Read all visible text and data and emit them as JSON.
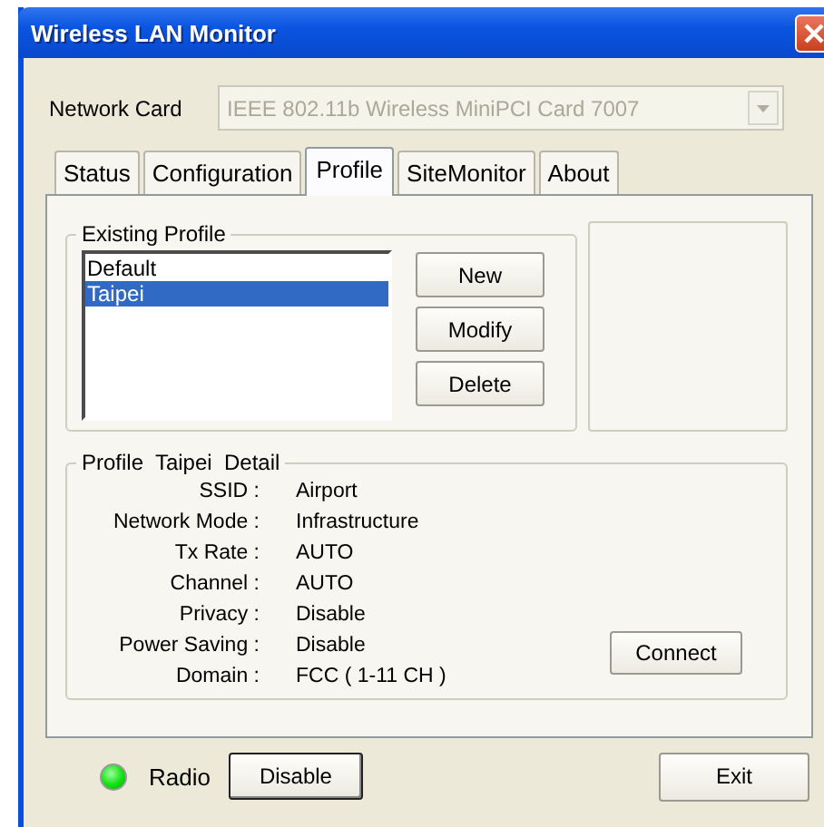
{
  "window": {
    "title": "Wireless LAN Monitor"
  },
  "network_card": {
    "label": "Network Card",
    "value": "IEEE 802.11b Wireless MiniPCI Card 7007",
    "disabled": true
  },
  "tabs": [
    {
      "label": "Status",
      "selected": false
    },
    {
      "label": "Configuration",
      "selected": false
    },
    {
      "label": "Profile",
      "selected": true
    },
    {
      "label": "SiteMonitor",
      "selected": false
    },
    {
      "label": "About",
      "selected": false
    }
  ],
  "existing_profile": {
    "title": "Existing Profile",
    "profiles": [
      {
        "name": "Default",
        "selected": false
      },
      {
        "name": "Taipei",
        "selected": true
      }
    ],
    "buttons": [
      "New",
      "Modify",
      "Delete"
    ]
  },
  "detail": {
    "title": "Profile  Taipei  Detail",
    "fields": [
      {
        "label": "SSID :",
        "value": "Airport"
      },
      {
        "label": "Network Mode :",
        "value": "Infrastructure"
      },
      {
        "label": "Tx Rate :",
        "value": "AUTO"
      },
      {
        "label": "Channel :",
        "value": "AUTO"
      },
      {
        "label": "Privacy :",
        "value": "Disable"
      },
      {
        "label": "Power Saving :",
        "value": "Disable"
      },
      {
        "label": "Domain :",
        "value": "FCC ( 1-11 CH )"
      }
    ],
    "connect_button": "Connect"
  },
  "radio": {
    "label": "Radio",
    "on": true,
    "button": "Disable",
    "button_default": true
  },
  "exit_button": "Exit"
}
